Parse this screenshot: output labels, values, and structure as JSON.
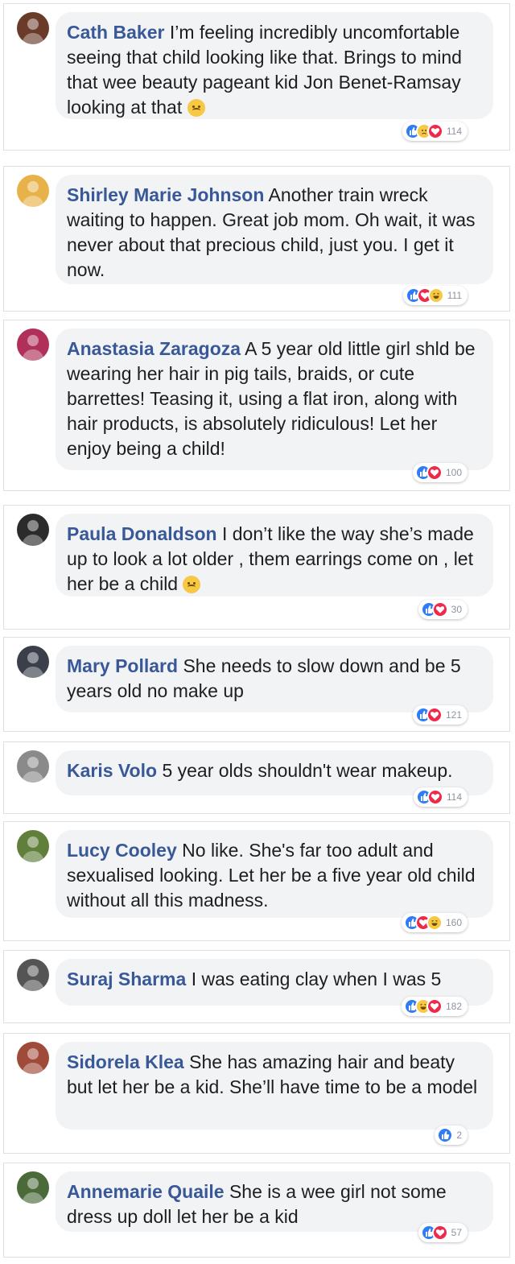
{
  "colors": {
    "name": "#385898",
    "bubble": "#f2f3f5",
    "like": "#2e7cf6",
    "love": "#f0284a",
    "emoji": "#f7c843"
  },
  "comments": [
    {
      "name": "Cath Baker",
      "text": "I’m feeling incredibly uncomfortable seeing that child looking like that. Brings to mind that wee beauty pageant kid Jon Benet-Ramsay looking at that",
      "trailing_emoji": "sad-face-icon",
      "reactions": [
        "like",
        "sad",
        "love"
      ],
      "count": "114"
    },
    {
      "name": "Shirley Marie Johnson",
      "text": "Another train wreck waiting to happen. Great job mom. Oh wait, it was never about that precious child, just you. I get it now.",
      "reactions": [
        "like",
        "love",
        "haha"
      ],
      "count": "111"
    },
    {
      "name": "Anastasia Zaragoza",
      "text": "A 5 year old little girl shld be wearing her hair in pig tails, braids, or cute barrettes! Teasing it, using a flat iron, along with hair products, is absolutely ridiculous! Let her enjoy being a child!",
      "reactions": [
        "like",
        "love"
      ],
      "count": "100"
    },
    {
      "name": "Paula Donaldson",
      "text": "I don’t like the way she’s made up to look a lot older , them earrings come on , let her be a child",
      "trailing_emoji": "sad-face-icon",
      "reactions": [
        "like",
        "love"
      ],
      "count": "30"
    },
    {
      "name": "Mary Pollard",
      "text": "She needs to slow down and be 5 years old no make up",
      "reactions": [
        "like",
        "love"
      ],
      "count": "121"
    },
    {
      "name": "Karis Volo",
      "text": "5 year olds shouldn't wear makeup.",
      "reactions": [
        "like",
        "love"
      ],
      "count": "114"
    },
    {
      "name": "Lucy Cooley",
      "text": "No like. She's far too adult and sexualised looking. Let her be a five year old child without all this madness.",
      "reactions": [
        "like",
        "love",
        "haha"
      ],
      "count": "160"
    },
    {
      "name": "Suraj Sharma",
      "text": "I was eating clay when I was 5",
      "reactions": [
        "like",
        "haha",
        "love"
      ],
      "count": "182"
    },
    {
      "name": "Sidorela Klea",
      "text": "She has amazing hair and beaty but let her be a kid. She’ll have time to be a model",
      "reactions": [
        "like"
      ],
      "count": "2"
    },
    {
      "name": "Annemarie Quaile",
      "text": "She is a wee girl not some dress up doll let her be a kid",
      "reactions": [
        "like",
        "love"
      ],
      "count": "57"
    }
  ]
}
